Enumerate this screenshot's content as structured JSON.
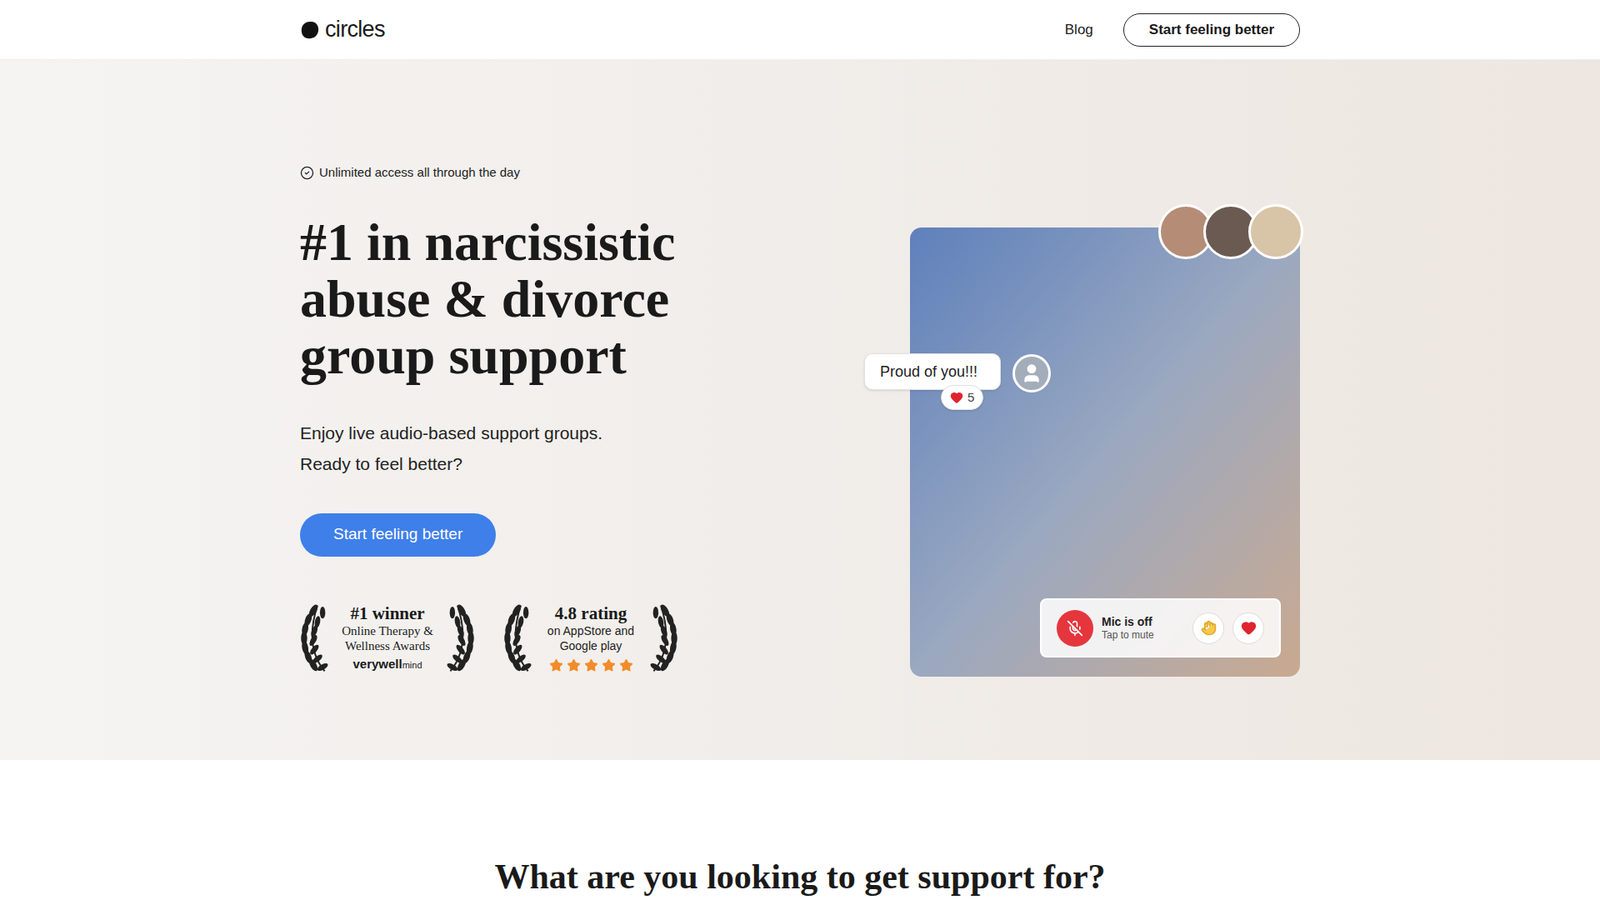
{
  "header": {
    "logo": "circles",
    "nav": [
      "Blog"
    ],
    "cta": "Start feeling better"
  },
  "hero": {
    "badge": "Unlimited access all through the day",
    "heading_lines": [
      "#1 in narcissistic",
      "abuse & divorce",
      "group support"
    ],
    "subtitle_lines": [
      "Enjoy live audio-based support groups.",
      "Ready to feel better?"
    ],
    "cta": "Start feeling better",
    "awards": [
      {
        "kind": "brand",
        "title": "#1 winner",
        "lines": [
          "Online Therapy &",
          "Wellness Awards"
        ],
        "brand": "verywell",
        "brand_suffix": "mind"
      },
      {
        "kind": "stars",
        "title": "4.8 rating",
        "lines": [
          "on AppStore and",
          "Google play"
        ],
        "stars": 5
      }
    ]
  },
  "call": {
    "comment": {
      "text": "Proud of you!!!",
      "count": "5"
    },
    "controls": {
      "mic_title": "Mic is off",
      "mic_hint": "Tap to mute",
      "mic_on": false
    }
  },
  "section": {
    "title": "What are you looking to get support for?"
  }
}
